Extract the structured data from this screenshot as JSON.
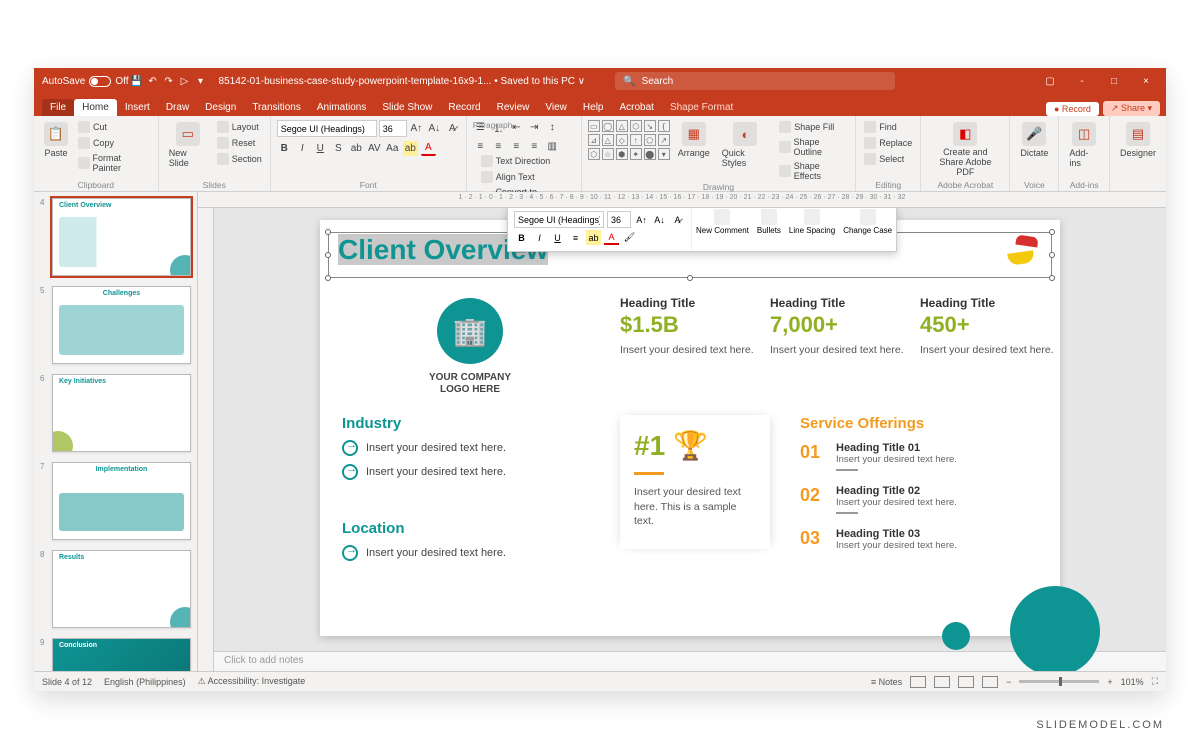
{
  "titlebar": {
    "autosave_label": "AutoSave",
    "autosave_state": "Off",
    "file_name": "85142-01-business-case-study-powerpoint-template-16x9-1...",
    "save_status": "Saved to this PC",
    "search_placeholder": "Search",
    "win_min": "-",
    "win_max": "□",
    "win_close": "×"
  },
  "tabs": {
    "file": "File",
    "home": "Home",
    "insert": "Insert",
    "draw": "Draw",
    "design": "Design",
    "transitions": "Transitions",
    "animations": "Animations",
    "slideshow": "Slide Show",
    "record": "Record",
    "review": "Review",
    "view": "View",
    "help": "Help",
    "acrobat": "Acrobat",
    "shape_format": "Shape Format",
    "record_btn": "Record",
    "share_btn": "Share"
  },
  "ribbon": {
    "clipboard": {
      "paste": "Paste",
      "cut": "Cut",
      "copy": "Copy",
      "format_painter": "Format Painter",
      "label": "Clipboard"
    },
    "slides": {
      "new_slide": "New Slide",
      "layout": "Layout",
      "reset": "Reset",
      "section": "Section",
      "label": "Slides"
    },
    "font": {
      "name": "Segoe UI (Headings)",
      "size": "36",
      "label": "Font"
    },
    "paragraph": {
      "text_direction": "Text Direction",
      "align_text": "Align Text",
      "convert": "Convert to SmartArt",
      "label": "Paragraph"
    },
    "drawing": {
      "arrange": "Arrange",
      "quick_styles": "Quick Styles",
      "shape_fill": "Shape Fill",
      "shape_outline": "Shape Outline",
      "shape_effects": "Shape Effects",
      "label": "Drawing"
    },
    "editing": {
      "find": "Find",
      "replace": "Replace",
      "select": "Select",
      "label": "Editing"
    },
    "adobe": {
      "create_share": "Create and Share Adobe PDF",
      "label": "Adobe Acrobat"
    },
    "voice": {
      "dictate": "Dictate",
      "label": "Voice"
    },
    "addins": {
      "btn": "Add-ins",
      "label": "Add-ins"
    },
    "designer": {
      "btn": "Designer"
    }
  },
  "ruler_h": "1 · 2 · 1 · 0 · 1 · 2 · 3 · 4 · 5 · 6 · 7 · 8 · 9 · 10 · 11 · 12 · 13 · 14 · 15 · 16 · 17 · 18 · 19 · 20 · 21 · 22 · 23 · 24 · 25 · 26 · 27 · 28 · 29 · 30 · 31 · 32",
  "mini_tb": {
    "font_name": "Segoe UI (Headings)",
    "font_size": "36",
    "new_comment": "New Comment",
    "bullets": "Bullets",
    "line_spacing": "Line Spacing",
    "change_case": "Change Case"
  },
  "thumbs": {
    "t4": {
      "title": "Client Overview"
    },
    "t5": {
      "title": "Challenges"
    },
    "t6": {
      "title": "Key Initiatives"
    },
    "t7": {
      "title": "Implementation"
    },
    "t8": {
      "title": "Results"
    },
    "t9": {
      "title": "Conclusion"
    }
  },
  "slide": {
    "title": "Client Overview",
    "logo_caption": "YOUR COMPANY\nLOGO HERE",
    "stats": [
      {
        "heading": "Heading Title",
        "value": "$1.5B",
        "desc": "Insert your desired text here."
      },
      {
        "heading": "Heading Title",
        "value": "7,000+",
        "desc": "Insert your desired text here."
      },
      {
        "heading": "Heading Title",
        "value": "450+",
        "desc": "Insert your desired text here."
      }
    ],
    "industry": {
      "h": "Industry",
      "items": [
        "Insert your desired text here.",
        "Insert your desired text here."
      ]
    },
    "location": {
      "h": "Location",
      "items": [
        "Insert your desired text here."
      ]
    },
    "rank": {
      "num": "#1",
      "desc": "Insert your desired text here. This is a sample text."
    },
    "services": {
      "h": "Service  Offerings",
      "items": [
        {
          "n": "01",
          "t": "Heading Title 01",
          "d": "Insert your desired text here."
        },
        {
          "n": "02",
          "t": "Heading Title 02",
          "d": "Insert your desired text here."
        },
        {
          "n": "03",
          "t": "Heading Title 03",
          "d": "Insert your desired text here."
        }
      ]
    }
  },
  "notes": "Click to add notes",
  "status": {
    "slide": "Slide 4 of 12",
    "lang": "English (Philippines)",
    "access": "Accessibility: Investigate",
    "notes_btn": "Notes",
    "zoom": "101%"
  },
  "watermark": "SLIDEMODEL.COM"
}
